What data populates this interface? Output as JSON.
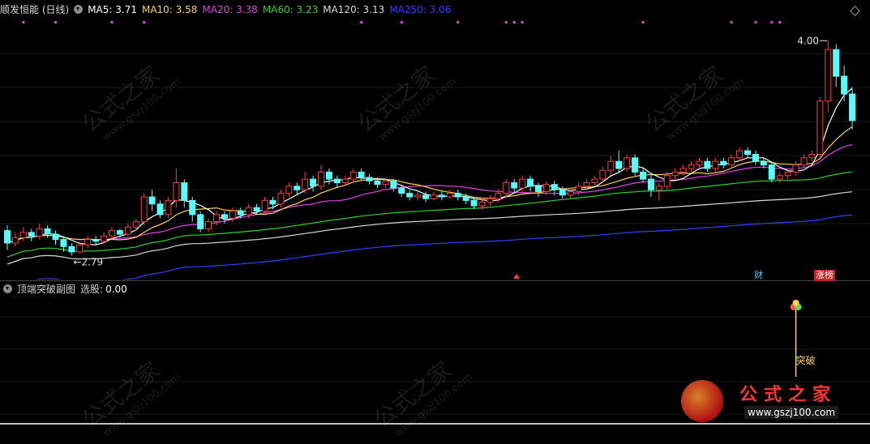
{
  "main_header": {
    "title": "顺发恒能 (日线)",
    "ma": [
      {
        "label": "MA5:",
        "value": "3.71",
        "color": "#ffffff"
      },
      {
        "label": "MA10:",
        "value": "3.58",
        "color": "#ffd24a"
      },
      {
        "label": "MA20:",
        "value": "3.38",
        "color": "#e040e0"
      },
      {
        "label": "MA60:",
        "value": "3.23",
        "color": "#30d030"
      },
      {
        "label": "MA120:",
        "value": "3.13",
        "color": "#d8d8d8"
      },
      {
        "label": "MA250:",
        "value": "3.06",
        "color": "#3040ff"
      }
    ]
  },
  "sub_header": {
    "title": "顶端突破副图",
    "pick_label": "选股:",
    "pick_value": "0.00"
  },
  "annotations": {
    "high": "4.00",
    "low": "←2.79",
    "breakout": "突破",
    "finance_tag": "财",
    "list_tag": "涨榜"
  },
  "watermark": {
    "cn": "公式之家",
    "url": "www.gszj100.com"
  },
  "brand": {
    "cn": "公式之家",
    "url": "www.gszj100.com"
  },
  "colors": {
    "up": "#ff3b3b",
    "down": "#54ffff",
    "ma5": "#ffffff",
    "ma10": "#ffd24a",
    "ma20": "#e040e0",
    "ma60": "#30d030",
    "ma120": "#d8d8d8",
    "ma250": "#3040ff"
  },
  "chart_data": {
    "type": "candlestick",
    "title": "顺发恒能 (日线)",
    "price_range": [
      2.79,
      4.0
    ],
    "candles": [
      [
        2.93,
        2.86,
        2.96,
        2.82
      ],
      [
        2.86,
        2.89,
        2.92,
        2.84
      ],
      [
        2.89,
        2.92,
        2.95,
        2.87
      ],
      [
        2.92,
        2.9,
        2.94,
        2.87
      ],
      [
        2.9,
        2.94,
        2.97,
        2.88
      ],
      [
        2.94,
        2.91,
        2.96,
        2.89
      ],
      [
        2.91,
        2.88,
        2.93,
        2.85
      ],
      [
        2.88,
        2.84,
        2.9,
        2.81
      ],
      [
        2.84,
        2.81,
        2.86,
        2.79
      ],
      [
        2.81,
        2.85,
        2.87,
        2.8
      ],
      [
        2.85,
        2.88,
        2.9,
        2.83
      ],
      [
        2.88,
        2.87,
        2.9,
        2.85
      ],
      [
        2.87,
        2.9,
        2.92,
        2.86
      ],
      [
        2.9,
        2.93,
        2.95,
        2.88
      ],
      [
        2.93,
        2.91,
        2.94,
        2.89
      ],
      [
        2.91,
        2.95,
        2.97,
        2.9
      ],
      [
        2.95,
        2.98,
        3.0,
        2.93
      ],
      [
        2.98,
        3.12,
        3.14,
        2.96
      ],
      [
        3.12,
        3.08,
        3.16,
        3.04
      ],
      [
        3.08,
        3.02,
        3.1,
        3.0
      ],
      [
        3.02,
        3.1,
        3.12,
        3.0
      ],
      [
        3.1,
        3.2,
        3.28,
        3.06
      ],
      [
        3.2,
        3.1,
        3.22,
        3.06
      ],
      [
        3.1,
        3.02,
        3.12,
        2.98
      ],
      [
        3.02,
        2.94,
        3.04,
        2.92
      ],
      [
        2.94,
        2.98,
        3.0,
        2.92
      ],
      [
        2.98,
        3.02,
        3.04,
        2.96
      ],
      [
        3.02,
        3.0,
        3.04,
        2.97
      ],
      [
        3.0,
        3.04,
        3.06,
        2.98
      ],
      [
        3.04,
        3.02,
        3.06,
        3.0
      ],
      [
        3.02,
        3.06,
        3.08,
        3.0
      ],
      [
        3.06,
        3.04,
        3.08,
        3.02
      ],
      [
        3.04,
        3.1,
        3.12,
        3.03
      ],
      [
        3.1,
        3.08,
        3.12,
        3.05
      ],
      [
        3.08,
        3.14,
        3.16,
        3.06
      ],
      [
        3.14,
        3.18,
        3.2,
        3.12
      ],
      [
        3.18,
        3.16,
        3.2,
        3.13
      ],
      [
        3.16,
        3.22,
        3.26,
        3.14
      ],
      [
        3.22,
        3.18,
        3.24,
        3.15
      ],
      [
        3.18,
        3.26,
        3.3,
        3.16
      ],
      [
        3.26,
        3.22,
        3.28,
        3.19
      ],
      [
        3.22,
        3.2,
        3.24,
        3.17
      ],
      [
        3.2,
        3.22,
        3.24,
        3.18
      ],
      [
        3.22,
        3.26,
        3.28,
        3.2
      ],
      [
        3.26,
        3.23,
        3.28,
        3.21
      ],
      [
        3.23,
        3.21,
        3.25,
        3.19
      ],
      [
        3.21,
        3.19,
        3.23,
        3.17
      ],
      [
        3.19,
        3.21,
        3.23,
        3.17
      ],
      [
        3.21,
        3.17,
        3.22,
        3.15
      ],
      [
        3.17,
        3.14,
        3.19,
        3.12
      ],
      [
        3.14,
        3.12,
        3.16,
        3.1
      ],
      [
        3.12,
        3.13,
        3.15,
        3.1
      ],
      [
        3.13,
        3.11,
        3.15,
        3.09
      ],
      [
        3.11,
        3.13,
        3.15,
        3.1
      ],
      [
        3.13,
        3.12,
        3.15,
        3.1
      ],
      [
        3.12,
        3.14,
        3.16,
        3.11
      ],
      [
        3.14,
        3.12,
        3.16,
        3.1
      ],
      [
        3.12,
        3.1,
        3.14,
        3.08
      ],
      [
        3.1,
        3.07,
        3.12,
        3.05
      ],
      [
        3.07,
        3.09,
        3.11,
        3.05
      ],
      [
        3.09,
        3.11,
        3.13,
        3.07
      ],
      [
        3.11,
        3.14,
        3.16,
        3.09
      ],
      [
        3.14,
        3.2,
        3.22,
        3.12
      ],
      [
        3.2,
        3.17,
        3.22,
        3.14
      ],
      [
        3.17,
        3.22,
        3.24,
        3.15
      ],
      [
        3.22,
        3.18,
        3.24,
        3.15
      ],
      [
        3.18,
        3.15,
        3.2,
        3.12
      ],
      [
        3.15,
        3.19,
        3.21,
        3.13
      ],
      [
        3.19,
        3.16,
        3.21,
        3.13
      ],
      [
        3.16,
        3.13,
        3.18,
        3.11
      ],
      [
        3.13,
        3.15,
        3.17,
        3.11
      ],
      [
        3.15,
        3.18,
        3.2,
        3.13
      ],
      [
        3.18,
        3.2,
        3.22,
        3.16
      ],
      [
        3.2,
        3.22,
        3.24,
        3.18
      ],
      [
        3.22,
        3.27,
        3.29,
        3.2
      ],
      [
        3.27,
        3.32,
        3.35,
        3.24
      ],
      [
        3.32,
        3.28,
        3.38,
        3.26
      ],
      [
        3.28,
        3.34,
        3.36,
        3.26
      ],
      [
        3.34,
        3.26,
        3.36,
        3.24
      ],
      [
        3.26,
        3.22,
        3.28,
        3.2
      ],
      [
        3.22,
        3.16,
        3.24,
        3.12
      ],
      [
        3.16,
        3.18,
        3.2,
        3.1
      ],
      [
        3.18,
        3.24,
        3.26,
        3.16
      ],
      [
        3.24,
        3.26,
        3.28,
        3.22
      ],
      [
        3.26,
        3.28,
        3.3,
        3.24
      ],
      [
        3.28,
        3.3,
        3.32,
        3.26
      ],
      [
        3.3,
        3.32,
        3.34,
        3.28
      ],
      [
        3.32,
        3.28,
        3.34,
        3.26
      ],
      [
        3.28,
        3.32,
        3.34,
        3.26
      ],
      [
        3.32,
        3.3,
        3.34,
        3.28
      ],
      [
        3.3,
        3.34,
        3.36,
        3.28
      ],
      [
        3.34,
        3.38,
        3.4,
        3.32
      ],
      [
        3.38,
        3.36,
        3.4,
        3.34
      ],
      [
        3.36,
        3.32,
        3.38,
        3.3
      ],
      [
        3.32,
        3.3,
        3.34,
        3.28
      ],
      [
        3.3,
        3.22,
        3.32,
        3.2
      ],
      [
        3.22,
        3.24,
        3.26,
        3.2
      ],
      [
        3.24,
        3.26,
        3.28,
        3.22
      ],
      [
        3.26,
        3.3,
        3.32,
        3.24
      ],
      [
        3.3,
        3.34,
        3.36,
        3.28
      ],
      [
        3.34,
        3.36,
        3.38,
        3.32
      ],
      [
        3.36,
        3.66,
        3.68,
        3.34
      ],
      [
        3.66,
        3.95,
        4.0,
        3.6
      ],
      [
        3.95,
        3.8,
        3.98,
        3.74
      ],
      [
        3.8,
        3.7,
        3.86,
        3.66
      ],
      [
        3.7,
        3.55,
        3.74,
        3.5
      ]
    ],
    "moving_averages": [
      "MA5",
      "MA10",
      "MA20",
      "MA60",
      "MA120",
      "MA250"
    ]
  }
}
